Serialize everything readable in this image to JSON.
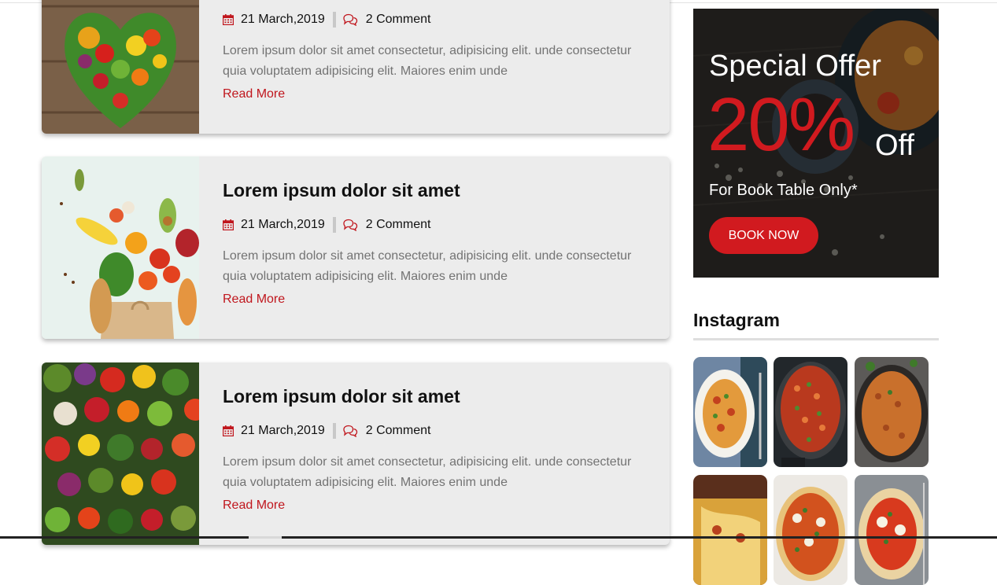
{
  "posts": [
    {
      "title": "",
      "date": "21 March,2019",
      "comments": "2 Comment",
      "excerpt": "Lorem ipsum dolor sit amet consectetur, adipisicing elit. unde consectetur quia voluptatem adipisicing elit. Maiores enim unde",
      "read_more": "Read More"
    },
    {
      "title": "Lorem ipsum dolor sit amet",
      "date": "21 March,2019",
      "comments": "2 Comment",
      "excerpt": "Lorem ipsum dolor sit amet consectetur, adipisicing elit. unde consectetur quia voluptatem adipisicing elit. Maiores enim unde",
      "read_more": "Read More"
    },
    {
      "title": "Lorem ipsum dolor sit amet",
      "date": "21 March,2019",
      "comments": "2 Comment",
      "excerpt": "Lorem ipsum dolor sit amet consectetur, adipisicing elit. unde consectetur quia voluptatem adipisicing elit. Maiores enim unde",
      "read_more": "Read More"
    }
  ],
  "offer": {
    "title": "Special Offer",
    "percent": "20%",
    "off": "Off",
    "subtitle": "For Book Table Only*",
    "button": "BOOK NOW"
  },
  "instagram": {
    "title": "Instagram"
  },
  "icons": {
    "date": "calendar-icon",
    "comments": "comment-icon"
  },
  "colors": {
    "accent": "#d11a1f",
    "card_bg": "#ececec",
    "excerpt_text": "#737373"
  }
}
